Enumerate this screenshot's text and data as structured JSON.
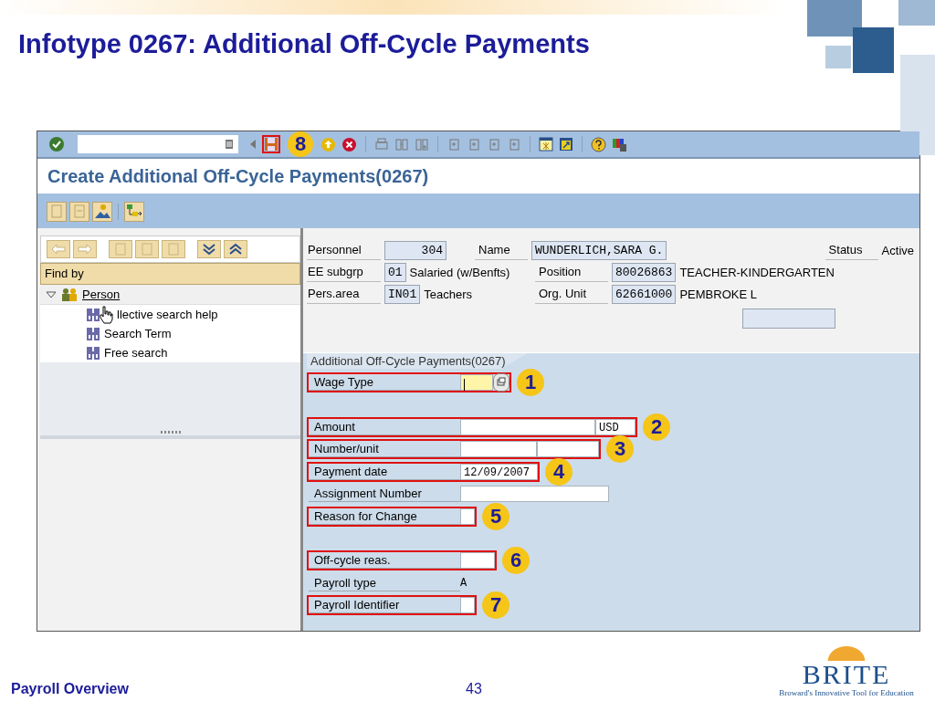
{
  "slide": {
    "title": "Infotype 0267: Additional Off-Cycle Payments",
    "footer_left": "Payroll Overview",
    "page_number": "43",
    "logo_text": "BRITE",
    "logo_tagline": "Broward's Innovative Tool for Education"
  },
  "toolbar": {
    "save_highlighted": true,
    "save_marker": "8"
  },
  "screen_title": "Create Additional Off-Cycle Payments(0267)",
  "left_panel": {
    "find_by": "Find by",
    "tree": [
      {
        "label": "Person",
        "expanded": true,
        "children": [
          {
            "label": "llective search help",
            "pointer": true
          },
          {
            "label": "Search Term",
            "pointer": false
          },
          {
            "label": "Free search",
            "pointer": false
          }
        ]
      }
    ]
  },
  "header_rows": [
    [
      {
        "label": "Personnel",
        "value": "304"
      },
      {
        "label": "Name",
        "value": "WUNDERLICH,SARA G."
      },
      {
        "label": "Status",
        "text": "Active"
      }
    ],
    [
      {
        "label": "EE subgrp",
        "value": "01",
        "text": "Salaried (w/Benfts)"
      },
      {
        "label": "Position",
        "value": "80026863",
        "text": "TEACHER-KINDERGARTEN"
      }
    ],
    [
      {
        "label": "Pers.area",
        "value": "IN01",
        "text": "Teachers"
      },
      {
        "label": "Org. Unit",
        "value": "62661000",
        "text": "PEMBROKE L"
      }
    ]
  ],
  "form": {
    "tab": "Additional Off-Cycle Payments(0267)",
    "fields": [
      {
        "label": "Wage Type",
        "kind": "f4",
        "focused": true,
        "highlighted": true,
        "marker": "1",
        "group_start": false
      },
      {
        "label": "Amount",
        "kind": "amount",
        "currency": "USD",
        "highlighted": true,
        "marker": "2",
        "group_start": true
      },
      {
        "label": "Number/unit",
        "kind": "pair",
        "highlighted": true,
        "marker": "3",
        "group_start": false
      },
      {
        "label": "Payment date",
        "kind": "date",
        "value": "12/09/2007",
        "highlighted": true,
        "marker": "4",
        "group_start": false
      },
      {
        "label": "Assignment Number",
        "kind": "long",
        "highlighted": false,
        "group_start": false
      },
      {
        "label": "Reason for Change",
        "kind": "tiny",
        "highlighted": true,
        "marker": "5",
        "group_start": false
      },
      {
        "label": "Off-cycle reas.",
        "kind": "short",
        "highlighted": true,
        "marker": "6",
        "group_start": true
      },
      {
        "label": "Payroll type",
        "kind": "text",
        "value": "A",
        "highlighted": false,
        "group_start": false
      },
      {
        "label": "Payroll Identifier",
        "kind": "tiny",
        "highlighted": true,
        "marker": "7",
        "group_start": false
      }
    ]
  }
}
